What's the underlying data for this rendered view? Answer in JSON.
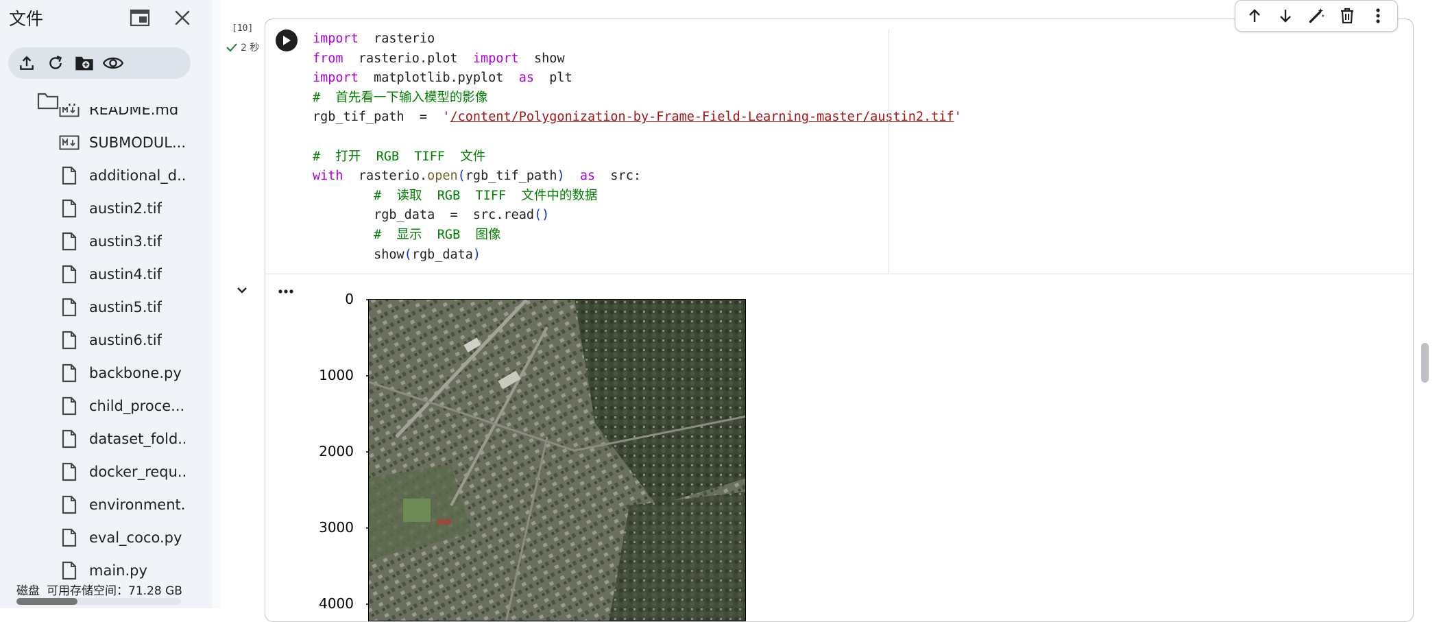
{
  "sidebar": {
    "title": "文件",
    "icons": {
      "new_window": "new-window-icon",
      "close": "close-icon"
    },
    "toolbar": [
      "upload-icon",
      "refresh-icon",
      "new-folder-icon",
      "eye-icon"
    ],
    "parent_label": "..",
    "files": [
      {
        "name": "README.md",
        "icon": "markdown-icon"
      },
      {
        "name": "SUBMODUL...",
        "icon": "markdown-icon"
      },
      {
        "name": "additional_d...",
        "icon": "file-icon"
      },
      {
        "name": "austin2.tif",
        "icon": "file-icon"
      },
      {
        "name": "austin3.tif",
        "icon": "file-icon"
      },
      {
        "name": "austin4.tif",
        "icon": "file-icon"
      },
      {
        "name": "austin5.tif",
        "icon": "file-icon"
      },
      {
        "name": "austin6.tif",
        "icon": "file-icon"
      },
      {
        "name": "backbone.py",
        "icon": "file-icon"
      },
      {
        "name": "child_proce...",
        "icon": "file-icon"
      },
      {
        "name": "dataset_fold...",
        "icon": "file-icon"
      },
      {
        "name": "docker_requ...",
        "icon": "file-icon"
      },
      {
        "name": "environment...",
        "icon": "file-icon"
      },
      {
        "name": "eval_coco.py",
        "icon": "file-icon"
      },
      {
        "name": "main.py",
        "icon": "file-icon"
      }
    ],
    "disk_label": "磁盘",
    "disk_space": "可用存储空间：71.28 GB",
    "disk_used_fraction": 0.37
  },
  "cell": {
    "exec_count": "[10]",
    "exec_time": "2 秒",
    "code_lines": {
      "l1_kw": "import",
      "l1_rest": "  rasterio",
      "l2_kw": "from",
      "l2_mod": "  rasterio.plot  ",
      "l2_kw2": "import",
      "l2_rest": "  show",
      "l3_kw": "import",
      "l3_mod": "  matplotlib.pyplot  ",
      "l3_kw2": "as",
      "l3_rest": "  plt",
      "l4": "#  首先看一下输入模型的影像",
      "l5_var": "rgb_tif_path  =  ",
      "l5_q1": "'",
      "l5_path": "/content/Polygonization-by-Frame-Field-Learning-master/austin2.tif",
      "l5_q2": "'",
      "l6": "#  打开  RGB  TIFF  文件",
      "l7_kw": "with",
      "l7_a": "  rasterio.",
      "l7_fn": "open",
      "l7_p1": "(",
      "l7_arg": "rgb_tif_path",
      "l7_p2": ")",
      "l7_sp": "  ",
      "l7_kw2": "as",
      "l7_rest": "  src:",
      "l8": "#  读取  RGB  TIFF  文件中的数据",
      "l9_a": "rgb_data  =  src.read",
      "l9_p": "()",
      "l10": "#  显示  RGB  图像",
      "l11_a": "show",
      "l11_p1": "(",
      "l11_arg": "rgb_data",
      "l11_p2": ")"
    },
    "toolbar": [
      "arrow-up-icon",
      "arrow-down-icon",
      "edit-magic-icon",
      "delete-icon",
      "more-vert-icon"
    ]
  },
  "output": {
    "y_ticks": [
      "0",
      "1000",
      "2000",
      "3000",
      "4000"
    ]
  },
  "colors": {
    "sidebar_bg": "#f0f4f9",
    "keyword": "#af00db",
    "comment": "#008000",
    "string": "#a31515"
  }
}
